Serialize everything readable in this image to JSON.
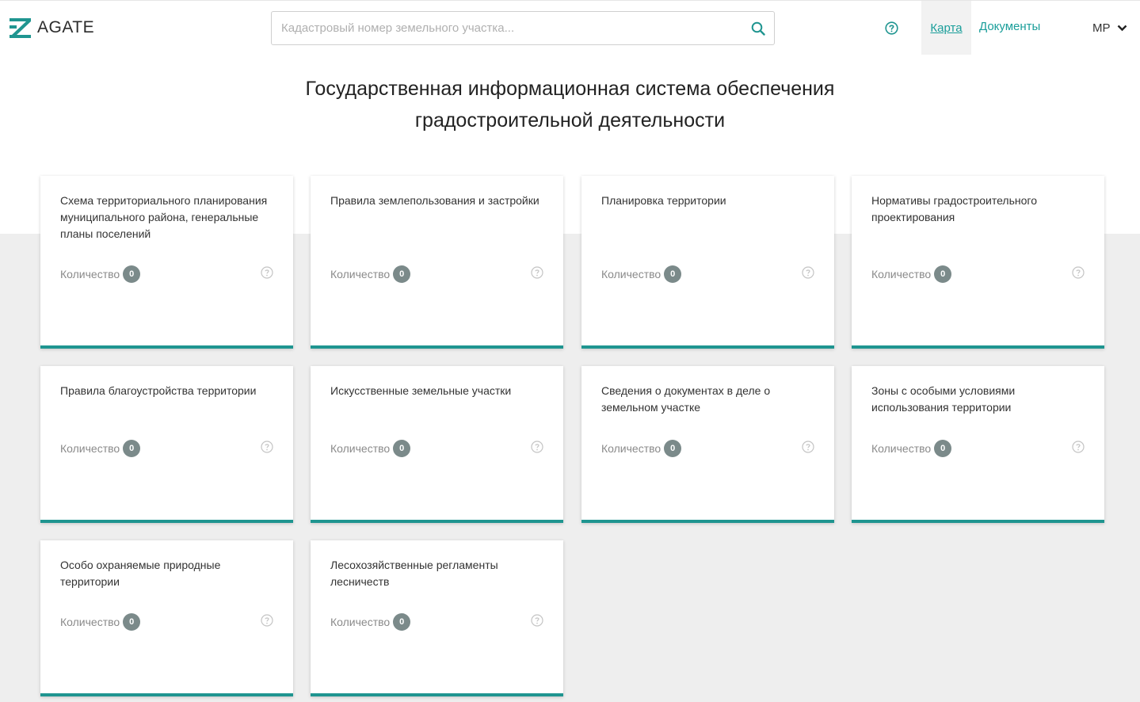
{
  "header": {
    "logo_text": "AGATE",
    "search_placeholder": "Кадастровый номер земельного участка...",
    "nav_map": "Карта",
    "nav_docs": "Документы",
    "user_initials": "МР"
  },
  "page_title_line1": "Государственная информационная система обеспечения",
  "page_title_line2": "градостроительной деятельности",
  "count_label": "Количество",
  "cards": [
    {
      "title": "Схема территориального планирования муниципального района, генеральные планы поселений",
      "count": "0"
    },
    {
      "title": "Правила землепользования и застройки",
      "count": "0"
    },
    {
      "title": "Планировка территории",
      "count": "0"
    },
    {
      "title": "Нормативы градостроительного проектирования",
      "count": "0"
    },
    {
      "title": "Правила благоустройства территории",
      "count": "0"
    },
    {
      "title": "Искусственные земельные участки",
      "count": "0"
    },
    {
      "title": "Сведения о документах в деле о земельном участке",
      "count": "0"
    },
    {
      "title": "Зоны с особыми условиями использования территории",
      "count": "0"
    },
    {
      "title": "Особо охраняемые природные территории",
      "count": "0"
    },
    {
      "title": "Лесохозяйственные регламенты лесничеств",
      "count": "0"
    }
  ],
  "colors": {
    "accent": "#1f9590",
    "link": "#1a9e9a",
    "badge": "#7b8a8a",
    "background_band": "#eeeeee"
  }
}
